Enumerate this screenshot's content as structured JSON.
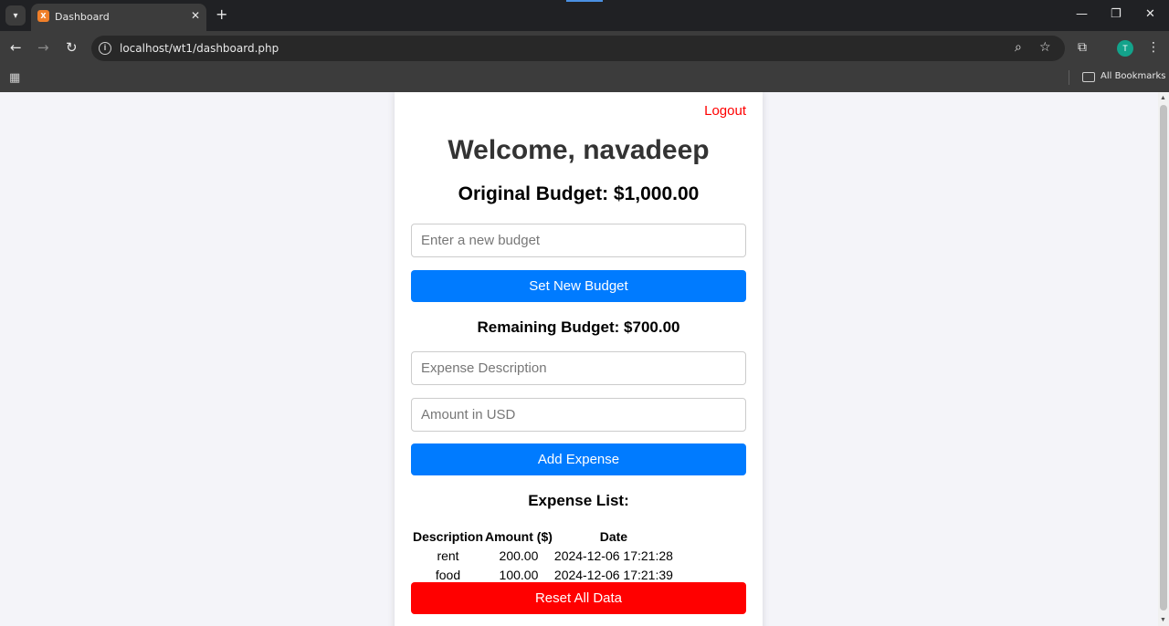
{
  "browser": {
    "tab_title": "Dashboard",
    "favicon_text": "X",
    "url": "localhost/wt1/dashboard.php",
    "bookmarks_label": "All Bookmarks",
    "profile_initial": "T"
  },
  "page": {
    "logout_label": "Logout",
    "welcome": "Welcome, navadeep",
    "original_budget": "Original Budget: $1,000.00",
    "new_budget_placeholder": "Enter a new budget",
    "set_budget_label": "Set New Budget",
    "remaining_budget": "Remaining Budget: $700.00",
    "description_placeholder": "Expense Description",
    "amount_placeholder": "Amount in USD",
    "add_expense_label": "Add Expense",
    "expense_list_title": "Expense List:",
    "table_headers": [
      "Description",
      "Amount ($)",
      "Date"
    ],
    "expenses": [
      [
        "rent",
        "200.00",
        "2024-12-06 17:21:28"
      ],
      [
        "food",
        "100.00",
        "2024-12-06 17:21:39"
      ]
    ],
    "reset_label": "Reset All Data"
  },
  "colors": {
    "primary": "#007bff",
    "danger": "#ff0000"
  }
}
